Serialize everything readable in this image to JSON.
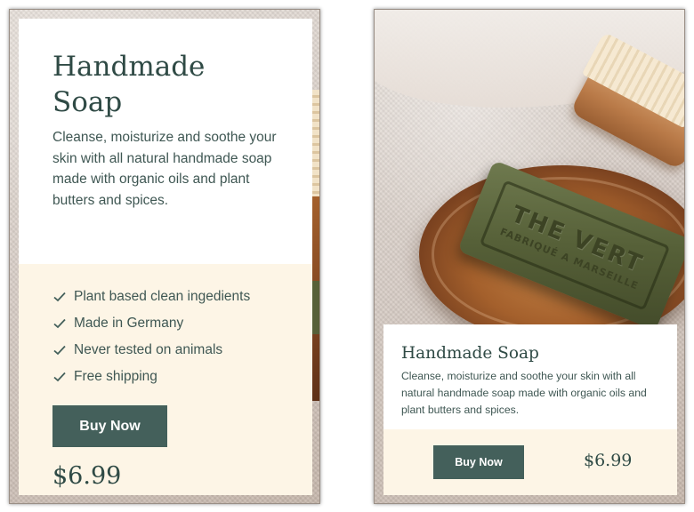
{
  "card_full": {
    "title": "Handmade Soap",
    "description": "Cleanse, moisturize and soothe your skin with all natural handmade soap made with organic oils and plant butters and spices.",
    "features": [
      "Plant based clean ingedients",
      "Made in Germany",
      "Never tested on animals",
      "Free shipping"
    ],
    "buy_label": "Buy Now",
    "price": "$6.99"
  },
  "card_compact": {
    "title": "Handmade Soap",
    "description": "Cleanse, moisturize and soothe your skin with all natural handmade soap made with organic oils and plant butters and spices.",
    "buy_label": "Buy Now",
    "price": "$6.99",
    "soap_stamp": {
      "title": "THE VERT",
      "subtitle": "FABRIQUÉ A MARSEILLE"
    }
  },
  "icons": {
    "feature_bullet": "check-icon"
  },
  "colors": {
    "accent": "#44605b",
    "text": "#2f4a45",
    "cream": "#fdf5e6",
    "white": "#ffffff"
  }
}
